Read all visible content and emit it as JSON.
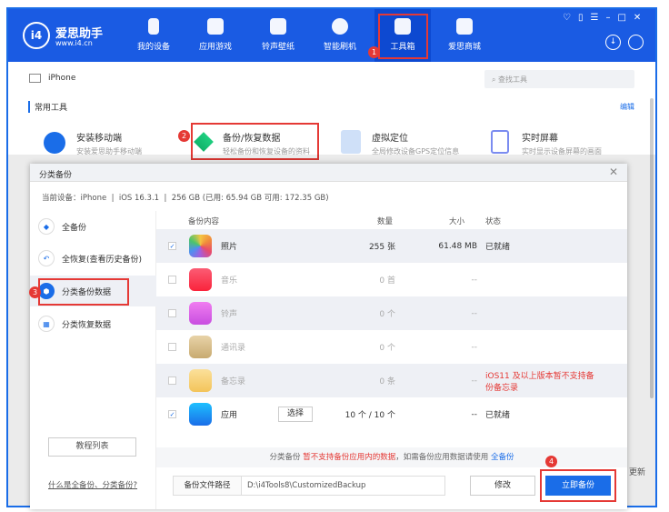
{
  "app": {
    "logo_name": "爱思助手",
    "logo_url": "www.i4.cn"
  },
  "nav": [
    {
      "label": "我的设备",
      "icon": "phone-icon"
    },
    {
      "label": "应用游戏",
      "icon": "cube-icon"
    },
    {
      "label": "铃声壁纸",
      "icon": "music-folder-icon"
    },
    {
      "label": "智能刷机",
      "icon": "shield-icon"
    },
    {
      "label": "工具箱",
      "icon": "toolbox-icon",
      "active": true
    },
    {
      "label": "爱思商城",
      "icon": "shopping-bag-icon"
    }
  ],
  "steps": [
    "1",
    "2",
    "3",
    "4"
  ],
  "device": "iPhone",
  "search": {
    "placeholder": "查找工具"
  },
  "section": {
    "title": "常用工具",
    "edit": "编辑"
  },
  "tools": [
    {
      "title": "安装移动端",
      "sub": "安装爱思助手移动端"
    },
    {
      "title": "备份/恢复数据",
      "sub": "轻松备份和恢复设备的资料"
    },
    {
      "title": "虚拟定位",
      "sub": "全局修改设备GPS定位信息"
    },
    {
      "title": "实时屏幕",
      "sub": "实时显示设备屏幕的画面"
    }
  ],
  "bg_update": "更新",
  "dialog": {
    "title": "分类备份",
    "info": "当前设备：iPhone  |  iOS 16.3.1  |  256 GB (已用: 65.94 GB 可用: 172.35 GB)",
    "sidebar": [
      "全备份",
      "全恢复(查看历史备份)",
      "分类备份数据",
      "分类恢复数据"
    ],
    "tutorial": "教程列表",
    "help_link": "什么是全备份、分类备份?",
    "columns": [
      "备份内容",
      "数量",
      "大小",
      "状态"
    ],
    "rows": [
      {
        "name": "照片",
        "count": "255 张",
        "size": "61.48 MB",
        "status": "已就绪",
        "checked": true
      },
      {
        "name": "音乐",
        "count": "0 首",
        "size": "--",
        "status": "",
        "checked": false
      },
      {
        "name": "铃声",
        "count": "0 个",
        "size": "--",
        "status": "",
        "checked": false
      },
      {
        "name": "通讯录",
        "count": "0 个",
        "size": "--",
        "status": "",
        "checked": false
      },
      {
        "name": "备忘录",
        "count": "0 条",
        "size": "--",
        "status": "iOS11 及以上版本暂不支持备份备忘录",
        "checked": false
      },
      {
        "name": "应用",
        "count": "10 个 / 10 个",
        "size": "--",
        "status": "已就绪",
        "checked": true,
        "select": "选择"
      }
    ],
    "notice": {
      "a": "分类备份 ",
      "b": "暂不支持备份应用内的数据",
      "c": "，如需备份应用数据请使用 ",
      "d": "全备份"
    },
    "path_label": "备份文件路径",
    "path": "D:\\i4Tools8\\CustomizedBackup",
    "modify": "修改",
    "backup": "立即备份"
  },
  "colors": {
    "brand": "#1a5be3",
    "primary_button": "#1a6de8",
    "warning": "#e53935"
  }
}
